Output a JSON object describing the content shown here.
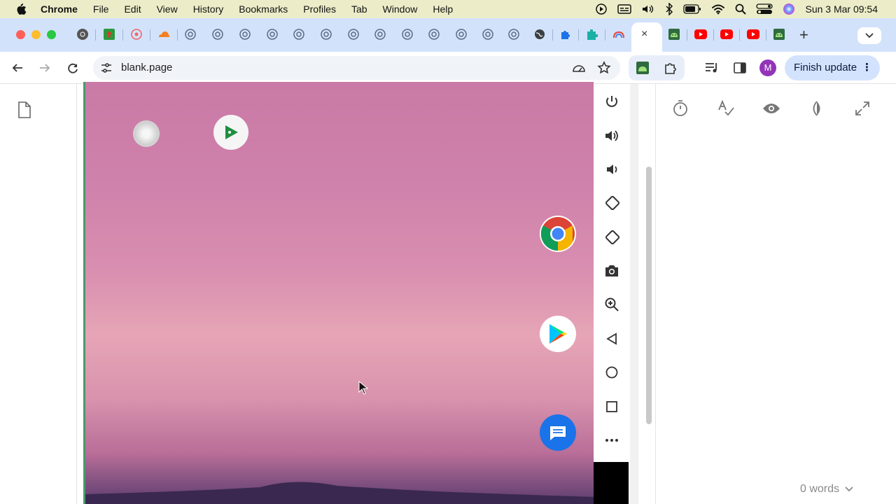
{
  "menubar": {
    "app": "Chrome",
    "items": [
      "File",
      "Edit",
      "View",
      "History",
      "Bookmarks",
      "Profiles",
      "Tab",
      "Window",
      "Help"
    ],
    "clock": "Sun 3 Mar  09:54",
    "icons": [
      "play-circle-icon",
      "captions-icon",
      "volume-icon",
      "bluetooth-icon",
      "battery-icon",
      "wifi-icon",
      "search-icon",
      "control-center-icon",
      "siri-icon"
    ]
  },
  "tabs": {
    "favicons": [
      "chrome-logo-icon",
      "upload-app-icon",
      "lens-icon",
      "cloudflare-icon",
      "loading-icon",
      "loading-icon",
      "loading-icon",
      "loading-icon",
      "loading-icon",
      "loading-icon",
      "loading-icon",
      "loading-icon",
      "loading-icon",
      "loading-icon",
      "loading-icon",
      "loading-icon",
      "globe-icon",
      "extension-icon",
      "puzzle-icon",
      "android-studio-icon"
    ],
    "active_close": "×",
    "trailing_favicons": [
      "android-emulator-icon",
      "youtube-icon",
      "youtube-icon",
      "youtube-icon",
      "android-emulator-icon"
    ],
    "new_tab": "+"
  },
  "toolbar": {
    "url": "blank.page",
    "avatar_letter": "M",
    "finish_update": "Finish update",
    "menu_dots": "⋮"
  },
  "emulator": {
    "apps": [
      "loading-app-icon",
      "play-games-icon",
      "chrome-icon",
      "play-store-icon",
      "messages-icon"
    ],
    "controls": [
      "power-icon",
      "volume-up-icon",
      "volume-down-icon",
      "rotate-left-icon",
      "rotate-right-icon",
      "camera-icon",
      "zoom-icon",
      "back-icon",
      "home-icon",
      "overview-icon",
      "more-icon"
    ]
  },
  "editor": {
    "tools": [
      "timer-icon",
      "spellcheck-icon",
      "eye-icon",
      "contrast-icon",
      "expand-icon"
    ],
    "word_count": "0 words"
  },
  "colors": {
    "menubar_bg": "#ecedc8",
    "tabstrip_bg": "#d3e2fb",
    "finish_bg": "#d3e3fd",
    "avatar_bg": "#9334b8"
  }
}
